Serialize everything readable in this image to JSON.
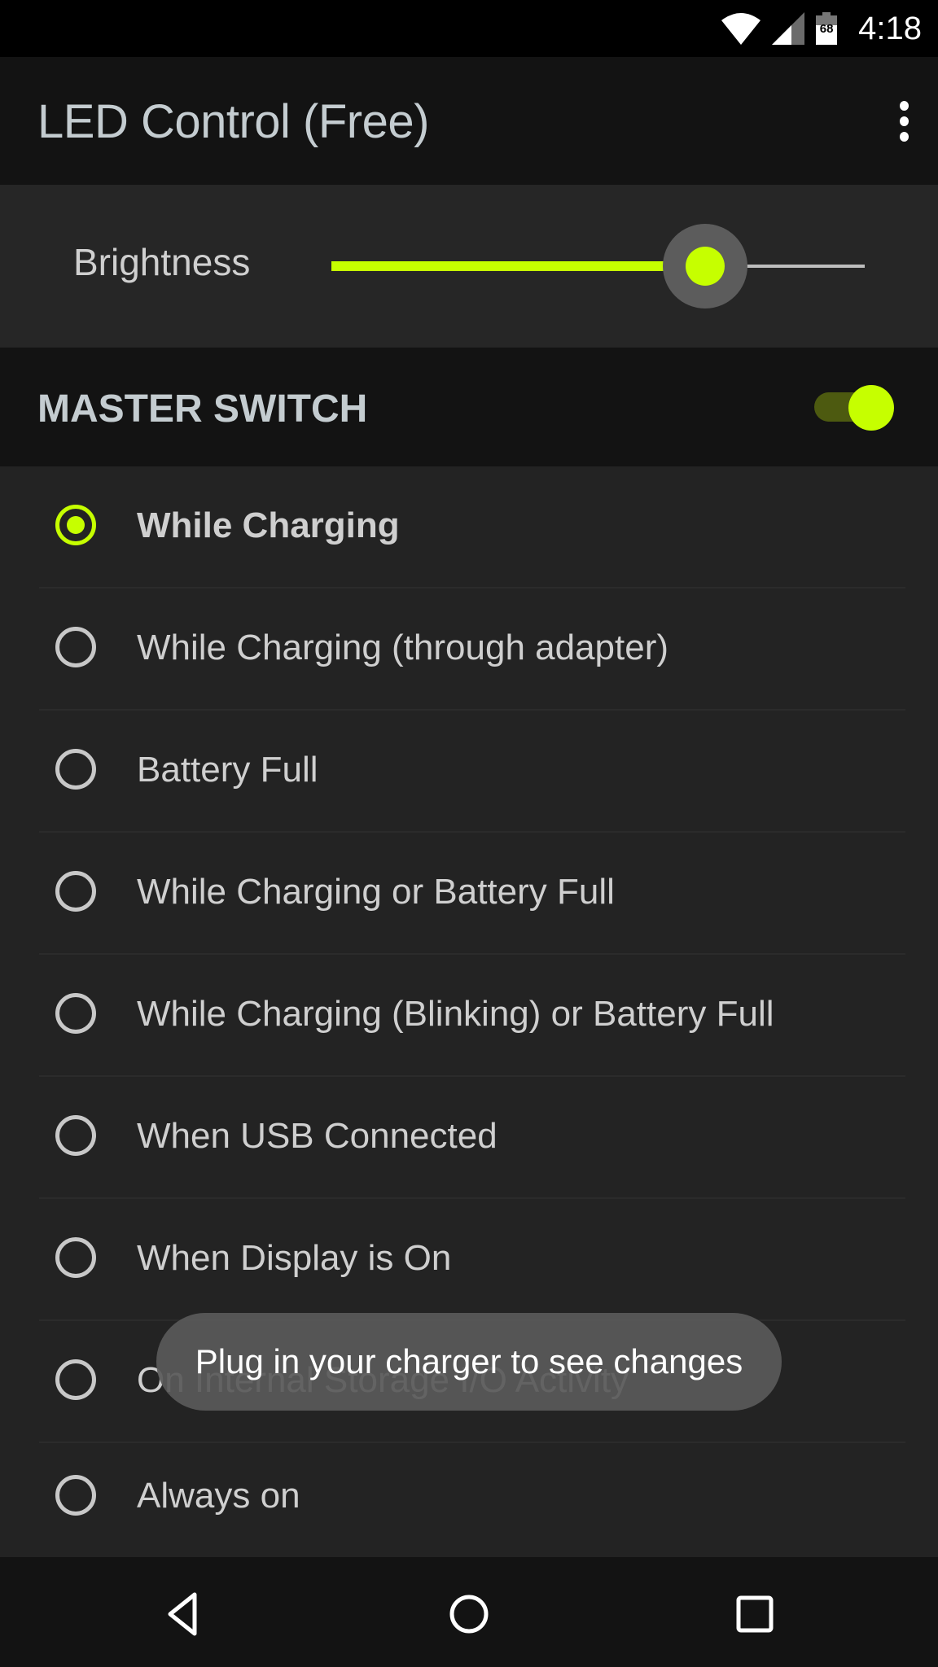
{
  "status_bar": {
    "time": "4:18",
    "battery_percent": "68",
    "icons": [
      "wifi-icon",
      "cell-signal-icon",
      "battery-icon"
    ]
  },
  "app_bar": {
    "title": "LED Control (Free)",
    "menu_icon": "overflow-menu-icon"
  },
  "brightness": {
    "label": "Brightness",
    "value_fraction": 0.7,
    "accent_color": "#c6ff00"
  },
  "master_switch": {
    "label": "MASTER SWITCH",
    "on": true
  },
  "options": [
    {
      "label": "While Charging",
      "selected": true
    },
    {
      "label": "While Charging (through adapter)",
      "selected": false
    },
    {
      "label": "Battery Full",
      "selected": false
    },
    {
      "label": "While Charging or Battery Full",
      "selected": false
    },
    {
      "label": "While Charging (Blinking) or Battery Full",
      "selected": false
    },
    {
      "label": "When USB Connected",
      "selected": false
    },
    {
      "label": "When Display is On",
      "selected": false
    },
    {
      "label": "On Internal Storage I/O Activity",
      "selected": false
    },
    {
      "label": "Always on",
      "selected": false
    }
  ],
  "toast": {
    "message": "Plug in your charger to see changes"
  },
  "nav_bar": {
    "buttons": [
      "back-icon",
      "home-icon",
      "recents-icon"
    ]
  }
}
